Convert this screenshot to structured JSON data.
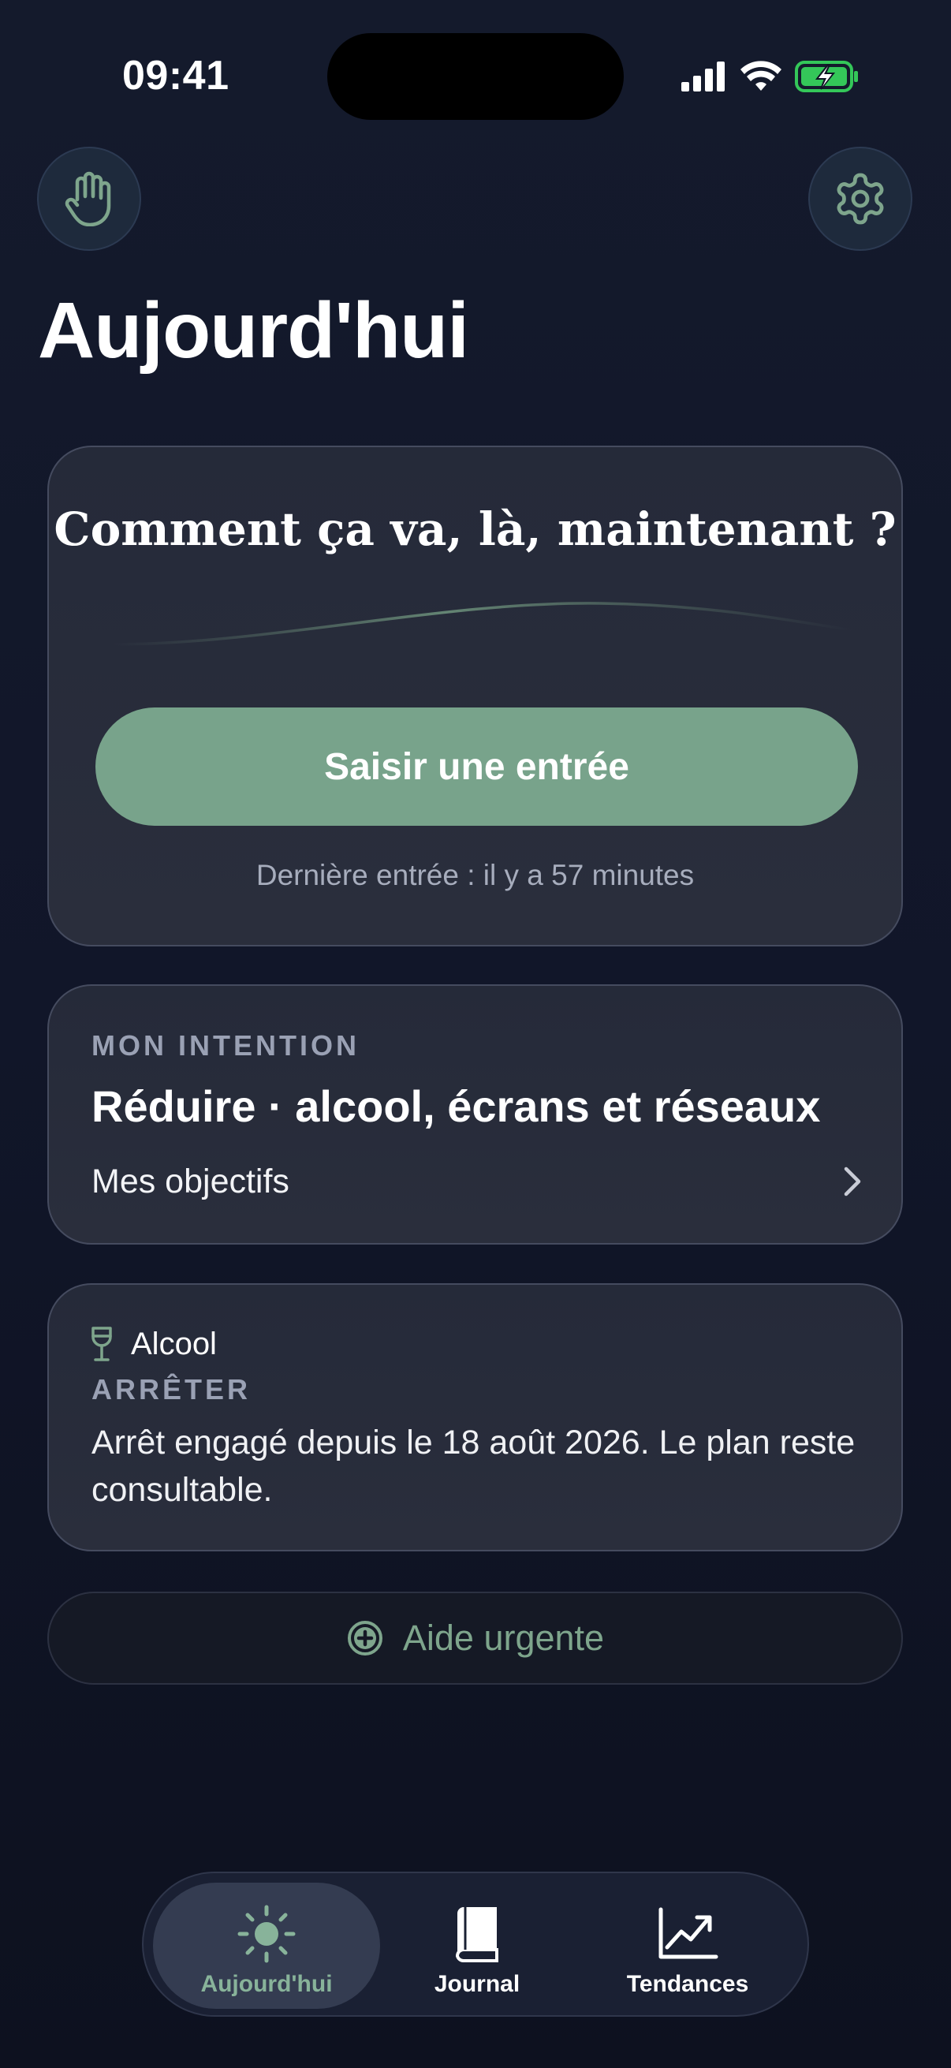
{
  "status_bar": {
    "time": "09:41"
  },
  "header": {
    "title": "Aujourd'hui"
  },
  "checkin": {
    "title": "Comment ça va, là, maintenant ?",
    "button_label": "Saisir une entrée",
    "last_entry": "Dernière entrée : il y a 57 minutes"
  },
  "intention": {
    "eyebrow": "MON INTENTION",
    "title": "Réduire · alcool, écrans et réseaux",
    "link_label": "Mes objectifs"
  },
  "alcohol": {
    "name": "Alcool",
    "eyebrow": "ARRÊTER",
    "text": "Arrêt engagé depuis le 18 août 2026. Le plan reste consultable."
  },
  "urgent": {
    "label": "Aide urgente"
  },
  "tabs": [
    {
      "label": "Aujourd'hui",
      "icon": "sun-icon",
      "active": true
    },
    {
      "label": "Journal",
      "icon": "book-icon",
      "active": false
    },
    {
      "label": "Tendances",
      "icon": "chart-line-icon",
      "active": false
    }
  ],
  "colors": {
    "accent": "#78a38b",
    "accent_text": "#88b39a",
    "background": "#141a2c",
    "card": "#262b39"
  }
}
